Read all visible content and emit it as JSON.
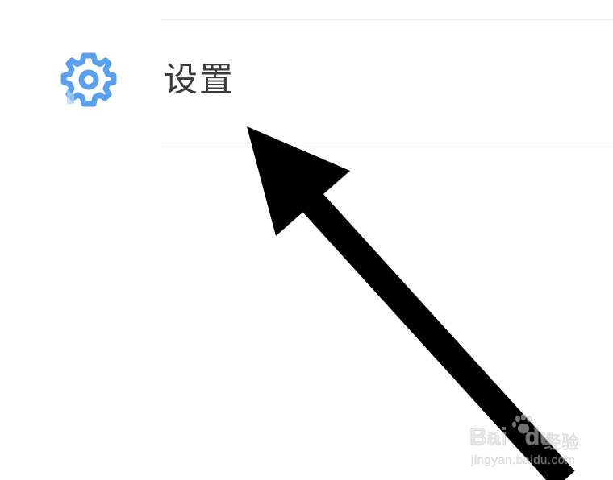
{
  "settings_item": {
    "label": "设置",
    "icon": "gear-icon",
    "icon_color": "#5aa0ec"
  },
  "annotation": {
    "type": "arrow",
    "color": "#000000"
  },
  "watermark": {
    "brand": "Bai",
    "brand_suffix": "du",
    "product": "经验",
    "url": "jingyan.baidu.com"
  }
}
